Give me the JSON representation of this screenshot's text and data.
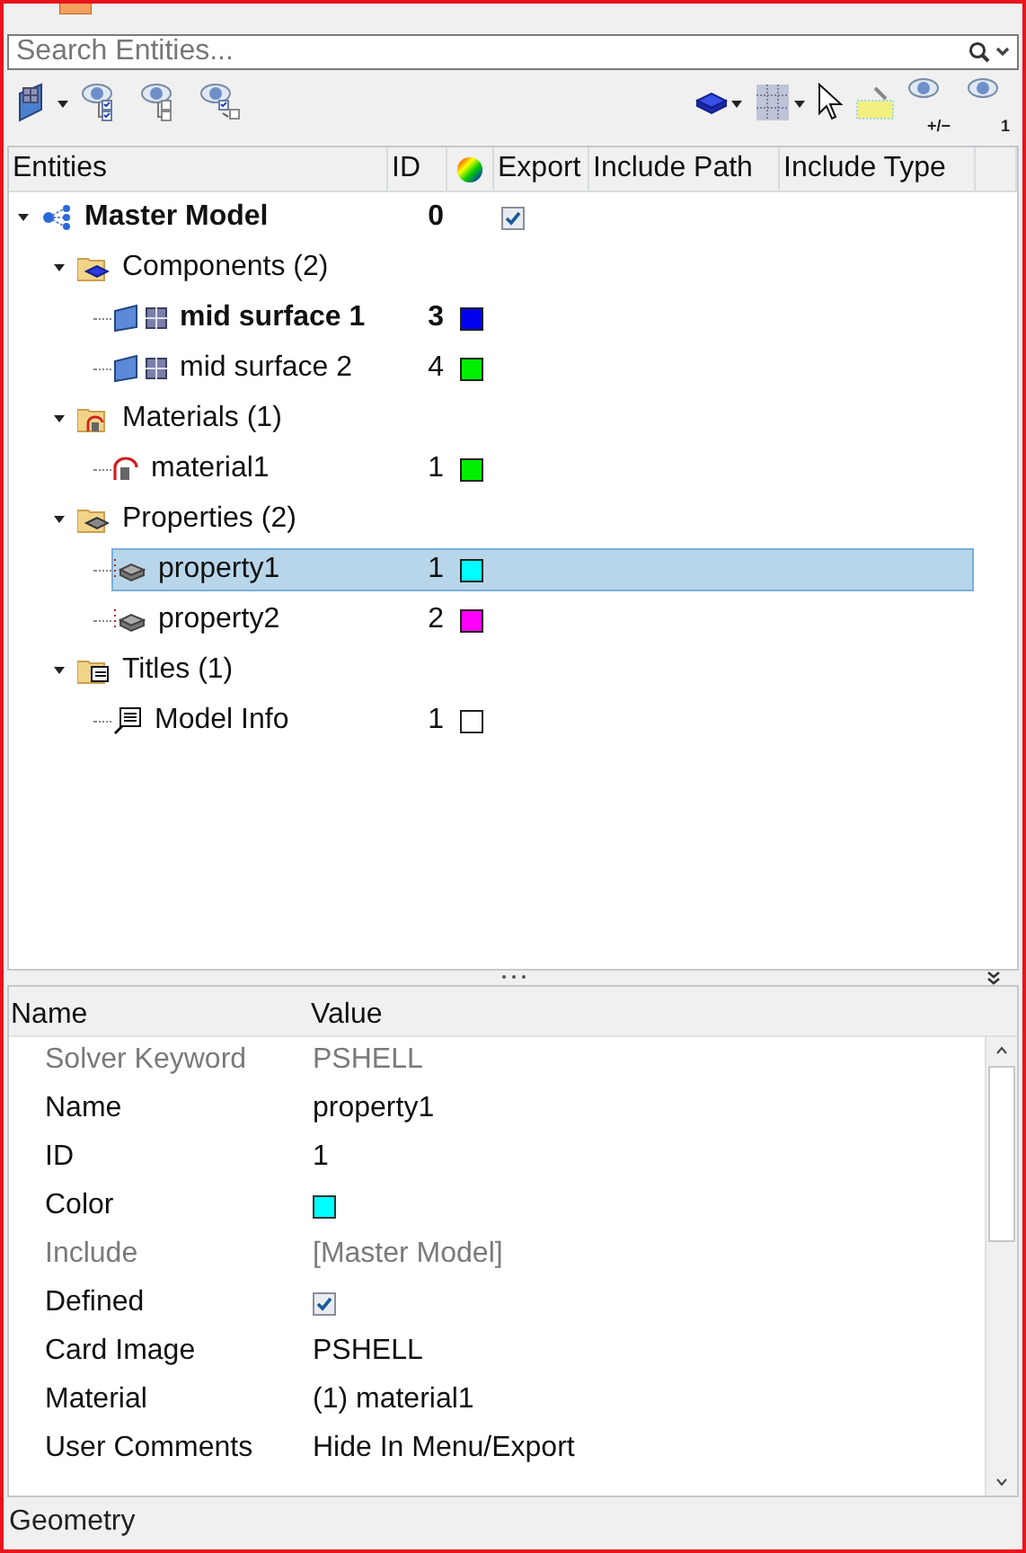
{
  "search": {
    "placeholder": "Search Entities..."
  },
  "toolbar": {
    "left": [
      {
        "kind": "surface",
        "dropdown": true
      },
      {
        "kind": "eye-show",
        "dropdown": false
      },
      {
        "kind": "eye-hide",
        "dropdown": false
      },
      {
        "kind": "eye-reverse",
        "dropdown": false
      }
    ],
    "right": [
      {
        "kind": "solid",
        "dropdown": true
      },
      {
        "kind": "mesh",
        "dropdown": true
      },
      {
        "kind": "cursor",
        "dropdown": false
      },
      {
        "kind": "highlight",
        "dropdown": false
      },
      {
        "kind": "eye",
        "dropdown": false,
        "label": "+/−"
      },
      {
        "kind": "eye",
        "dropdown": false,
        "label": "1"
      }
    ]
  },
  "tree": {
    "columns": [
      "Entities",
      "ID",
      {
        "kind": "color-wheel"
      },
      "Export",
      "Include Path",
      "Include Type"
    ],
    "rows": [
      {
        "kind": "model",
        "label": "Master Model",
        "id": "0",
        "bold": true,
        "export_checked": true,
        "expanded": true,
        "selected": false,
        "children": [
          {
            "kind": "components",
            "label": "Components (2)",
            "bold": false,
            "expanded": true,
            "selected": false,
            "children": [
              {
                "kind": "component",
                "label": "mid surface 1",
                "id": "3",
                "bold": true,
                "color": "#0000ee",
                "selected": false
              },
              {
                "kind": "component",
                "label": "mid surface 2",
                "id": "4",
                "bold": false,
                "color": "#00ee00",
                "selected": false
              }
            ]
          },
          {
            "kind": "materials",
            "label": "Materials (1)",
            "bold": false,
            "expanded": true,
            "selected": false,
            "children": [
              {
                "kind": "material",
                "label": "material1",
                "id": "1",
                "bold": false,
                "color": "#00ee00",
                "selected": false
              }
            ]
          },
          {
            "kind": "properties",
            "label": "Properties (2)",
            "bold": false,
            "expanded": true,
            "selected": false,
            "children": [
              {
                "kind": "property",
                "label": "property1",
                "id": "1",
                "bold": false,
                "color": "#00ffff",
                "selected": true
              },
              {
                "kind": "property",
                "label": "property2",
                "id": "2",
                "bold": false,
                "color": "#ff00ff",
                "selected": false
              }
            ]
          },
          {
            "kind": "titles",
            "label": "Titles (1)",
            "bold": false,
            "expanded": true,
            "selected": false,
            "children": [
              {
                "kind": "title",
                "label": "Model Info",
                "id": "1",
                "bold": false,
                "color": "#ffffff",
                "selected": false
              }
            ]
          }
        ]
      }
    ]
  },
  "properties": {
    "columns": [
      "Name",
      "Value"
    ],
    "rows": [
      {
        "kind": "text",
        "name": "Solver Keyword",
        "value": "PSHELL",
        "disabled": true
      },
      {
        "kind": "text",
        "name": "Name",
        "value": "property1",
        "disabled": false
      },
      {
        "kind": "text",
        "name": "ID",
        "value": "1",
        "disabled": false
      },
      {
        "kind": "color",
        "name": "Color",
        "color": "#00ffff",
        "disabled": false
      },
      {
        "kind": "text",
        "name": "Include",
        "value": "[Master Model]",
        "disabled": true
      },
      {
        "kind": "checkbox",
        "name": "Defined",
        "checked": true,
        "disabled": false
      },
      {
        "kind": "text",
        "name": "Card Image",
        "value": "PSHELL",
        "disabled": false
      },
      {
        "kind": "text",
        "name": "Material",
        "value": "(1) material1",
        "disabled": false
      },
      {
        "kind": "text",
        "name": "User Comments",
        "value": "Hide In Menu/Export",
        "disabled": false
      }
    ]
  },
  "status_bar": {
    "text": "Geometry"
  }
}
